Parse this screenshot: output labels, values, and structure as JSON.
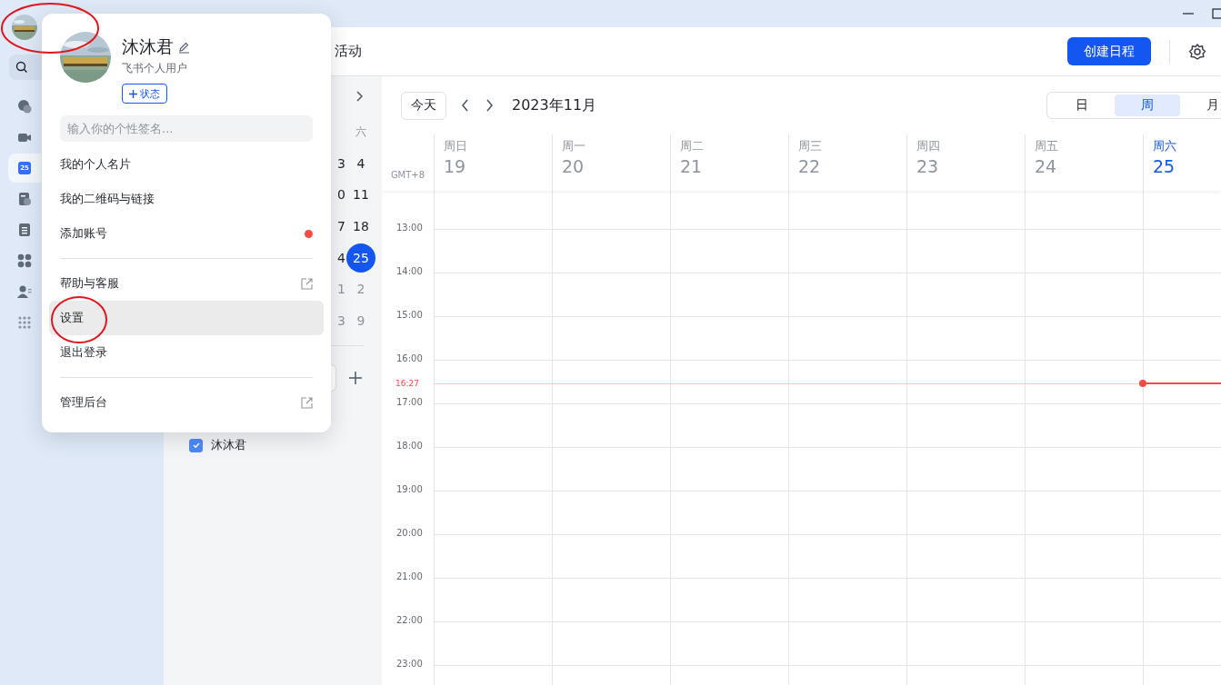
{
  "rail": {
    "items": [
      {
        "kind": "chat",
        "selected": false
      },
      {
        "kind": "video",
        "selected": false
      },
      {
        "kind": "calendar",
        "selected": true,
        "label": "25"
      },
      {
        "kind": "docs",
        "selected": false
      },
      {
        "kind": "sheet",
        "selected": false
      },
      {
        "kind": "apps",
        "selected": false
      },
      {
        "kind": "contacts",
        "selected": false
      },
      {
        "kind": "more",
        "selected": false
      }
    ]
  },
  "header": {
    "title": "活动",
    "create_button": "创建日程"
  },
  "mini_calendar": {
    "weekday": "六",
    "rows": [
      {
        "partial": "3",
        "day": "4",
        "selected": false,
        "muted": false
      },
      {
        "partial": "0",
        "day": "11",
        "selected": false,
        "muted": false
      },
      {
        "partial": "7",
        "day": "18",
        "selected": false,
        "muted": false
      },
      {
        "partial": "4",
        "day": "25",
        "selected": true,
        "muted": false
      },
      {
        "partial": "1",
        "day": "2",
        "selected": false,
        "muted": true
      },
      {
        "partial": "3",
        "day": "9",
        "selected": false,
        "muted": true
      }
    ]
  },
  "calendars": [
    {
      "name": "沐沐君",
      "checked": true
    }
  ],
  "toolbar": {
    "today": "今天",
    "month": "2023年11月",
    "views": [
      {
        "label": "日",
        "selected": false
      },
      {
        "label": "周",
        "selected": true
      },
      {
        "label": "月",
        "selected": false
      }
    ]
  },
  "week": {
    "timezone": "GMT+8",
    "days": [
      {
        "weekday": "周日",
        "date": "19",
        "today": false
      },
      {
        "weekday": "周一",
        "date": "20",
        "today": false
      },
      {
        "weekday": "周二",
        "date": "21",
        "today": false
      },
      {
        "weekday": "周三",
        "date": "22",
        "today": false
      },
      {
        "weekday": "周四",
        "date": "23",
        "today": false
      },
      {
        "weekday": "周五",
        "date": "24",
        "today": false
      },
      {
        "weekday": "周六",
        "date": "25",
        "today": true
      }
    ],
    "hours": [
      "13:00",
      "14:00",
      "15:00",
      "16:00",
      "17:00",
      "18:00",
      "19:00",
      "20:00",
      "21:00",
      "22:00",
      "23:00"
    ],
    "now": "16:27"
  },
  "popup": {
    "name": "沐沐君",
    "account_type": "飞书个人用户",
    "status_button": "状态",
    "signature_placeholder": "输入你的个性签名...",
    "menu_groups": [
      [
        {
          "label": "我的个人名片",
          "external": false,
          "badge": false,
          "highlighted": false
        },
        {
          "label": "我的二维码与链接",
          "external": false,
          "badge": false,
          "highlighted": false
        },
        {
          "label": "添加账号",
          "external": false,
          "badge": true,
          "highlighted": false
        }
      ],
      [
        {
          "label": "帮助与客服",
          "external": true,
          "badge": false,
          "highlighted": false
        },
        {
          "label": "设置",
          "external": false,
          "badge": false,
          "highlighted": true
        },
        {
          "label": "退出登录",
          "external": false,
          "badge": false,
          "highlighted": false
        }
      ],
      [
        {
          "label": "管理后台",
          "external": true,
          "badge": false,
          "highlighted": false
        }
      ]
    ]
  }
}
